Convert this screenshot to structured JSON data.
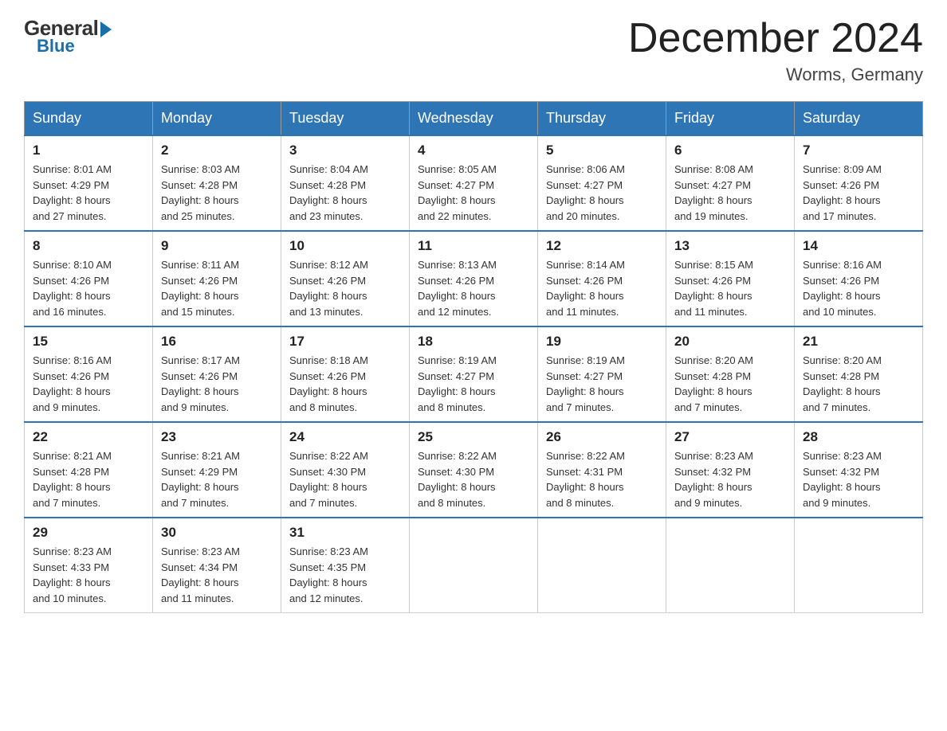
{
  "logo": {
    "general": "General",
    "blue": "Blue"
  },
  "title": "December 2024",
  "location": "Worms, Germany",
  "weekdays": [
    "Sunday",
    "Monday",
    "Tuesday",
    "Wednesday",
    "Thursday",
    "Friday",
    "Saturday"
  ],
  "weeks": [
    [
      {
        "day": "1",
        "sunrise": "8:01 AM",
        "sunset": "4:29 PM",
        "daylight": "8 hours and 27 minutes."
      },
      {
        "day": "2",
        "sunrise": "8:03 AM",
        "sunset": "4:28 PM",
        "daylight": "8 hours and 25 minutes."
      },
      {
        "day": "3",
        "sunrise": "8:04 AM",
        "sunset": "4:28 PM",
        "daylight": "8 hours and 23 minutes."
      },
      {
        "day": "4",
        "sunrise": "8:05 AM",
        "sunset": "4:27 PM",
        "daylight": "8 hours and 22 minutes."
      },
      {
        "day": "5",
        "sunrise": "8:06 AM",
        "sunset": "4:27 PM",
        "daylight": "8 hours and 20 minutes."
      },
      {
        "day": "6",
        "sunrise": "8:08 AM",
        "sunset": "4:27 PM",
        "daylight": "8 hours and 19 minutes."
      },
      {
        "day": "7",
        "sunrise": "8:09 AM",
        "sunset": "4:26 PM",
        "daylight": "8 hours and 17 minutes."
      }
    ],
    [
      {
        "day": "8",
        "sunrise": "8:10 AM",
        "sunset": "4:26 PM",
        "daylight": "8 hours and 16 minutes."
      },
      {
        "day": "9",
        "sunrise": "8:11 AM",
        "sunset": "4:26 PM",
        "daylight": "8 hours and 15 minutes."
      },
      {
        "day": "10",
        "sunrise": "8:12 AM",
        "sunset": "4:26 PM",
        "daylight": "8 hours and 13 minutes."
      },
      {
        "day": "11",
        "sunrise": "8:13 AM",
        "sunset": "4:26 PM",
        "daylight": "8 hours and 12 minutes."
      },
      {
        "day": "12",
        "sunrise": "8:14 AM",
        "sunset": "4:26 PM",
        "daylight": "8 hours and 11 minutes."
      },
      {
        "day": "13",
        "sunrise": "8:15 AM",
        "sunset": "4:26 PM",
        "daylight": "8 hours and 11 minutes."
      },
      {
        "day": "14",
        "sunrise": "8:16 AM",
        "sunset": "4:26 PM",
        "daylight": "8 hours and 10 minutes."
      }
    ],
    [
      {
        "day": "15",
        "sunrise": "8:16 AM",
        "sunset": "4:26 PM",
        "daylight": "8 hours and 9 minutes."
      },
      {
        "day": "16",
        "sunrise": "8:17 AM",
        "sunset": "4:26 PM",
        "daylight": "8 hours and 9 minutes."
      },
      {
        "day": "17",
        "sunrise": "8:18 AM",
        "sunset": "4:26 PM",
        "daylight": "8 hours and 8 minutes."
      },
      {
        "day": "18",
        "sunrise": "8:19 AM",
        "sunset": "4:27 PM",
        "daylight": "8 hours and 8 minutes."
      },
      {
        "day": "19",
        "sunrise": "8:19 AM",
        "sunset": "4:27 PM",
        "daylight": "8 hours and 7 minutes."
      },
      {
        "day": "20",
        "sunrise": "8:20 AM",
        "sunset": "4:28 PM",
        "daylight": "8 hours and 7 minutes."
      },
      {
        "day": "21",
        "sunrise": "8:20 AM",
        "sunset": "4:28 PM",
        "daylight": "8 hours and 7 minutes."
      }
    ],
    [
      {
        "day": "22",
        "sunrise": "8:21 AM",
        "sunset": "4:28 PM",
        "daylight": "8 hours and 7 minutes."
      },
      {
        "day": "23",
        "sunrise": "8:21 AM",
        "sunset": "4:29 PM",
        "daylight": "8 hours and 7 minutes."
      },
      {
        "day": "24",
        "sunrise": "8:22 AM",
        "sunset": "4:30 PM",
        "daylight": "8 hours and 7 minutes."
      },
      {
        "day": "25",
        "sunrise": "8:22 AM",
        "sunset": "4:30 PM",
        "daylight": "8 hours and 8 minutes."
      },
      {
        "day": "26",
        "sunrise": "8:22 AM",
        "sunset": "4:31 PM",
        "daylight": "8 hours and 8 minutes."
      },
      {
        "day": "27",
        "sunrise": "8:23 AM",
        "sunset": "4:32 PM",
        "daylight": "8 hours and 9 minutes."
      },
      {
        "day": "28",
        "sunrise": "8:23 AM",
        "sunset": "4:32 PM",
        "daylight": "8 hours and 9 minutes."
      }
    ],
    [
      {
        "day": "29",
        "sunrise": "8:23 AM",
        "sunset": "4:33 PM",
        "daylight": "8 hours and 10 minutes."
      },
      {
        "day": "30",
        "sunrise": "8:23 AM",
        "sunset": "4:34 PM",
        "daylight": "8 hours and 11 minutes."
      },
      {
        "day": "31",
        "sunrise": "8:23 AM",
        "sunset": "4:35 PM",
        "daylight": "8 hours and 12 minutes."
      },
      null,
      null,
      null,
      null
    ]
  ]
}
